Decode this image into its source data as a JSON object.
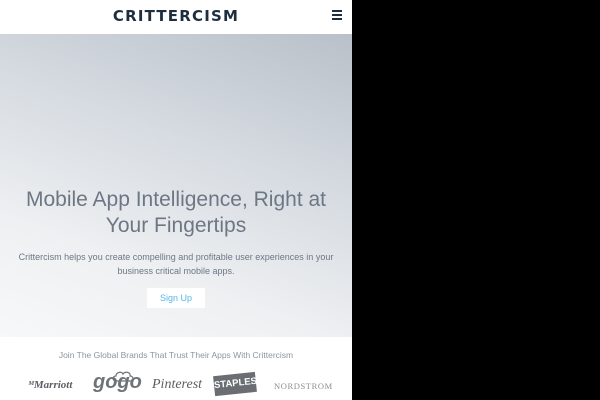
{
  "header": {
    "logo": "CRITTERCISM",
    "menu_icon": "hamburger-menu-icon"
  },
  "hero": {
    "headline": "Mobile App Intelligence, Right at Your Fingertips",
    "subtext": "Crittercism helps you create compelling and profitable user experiences in your business critical mobile apps.",
    "signup_label": "Sign Up"
  },
  "brands": {
    "title": "Join The Global Brands That Trust Their Apps With Crittercism",
    "logos": {
      "marriott": "Marriott",
      "gogo": "gogo",
      "pinterest": "Pinterest",
      "staples": "STAPLES",
      "nordstrom": "NORDSTROM"
    }
  },
  "colors": {
    "logo": "#1d2e3f",
    "accent": "#56b6e6",
    "text": "#6d7784",
    "outside": "#000000"
  }
}
